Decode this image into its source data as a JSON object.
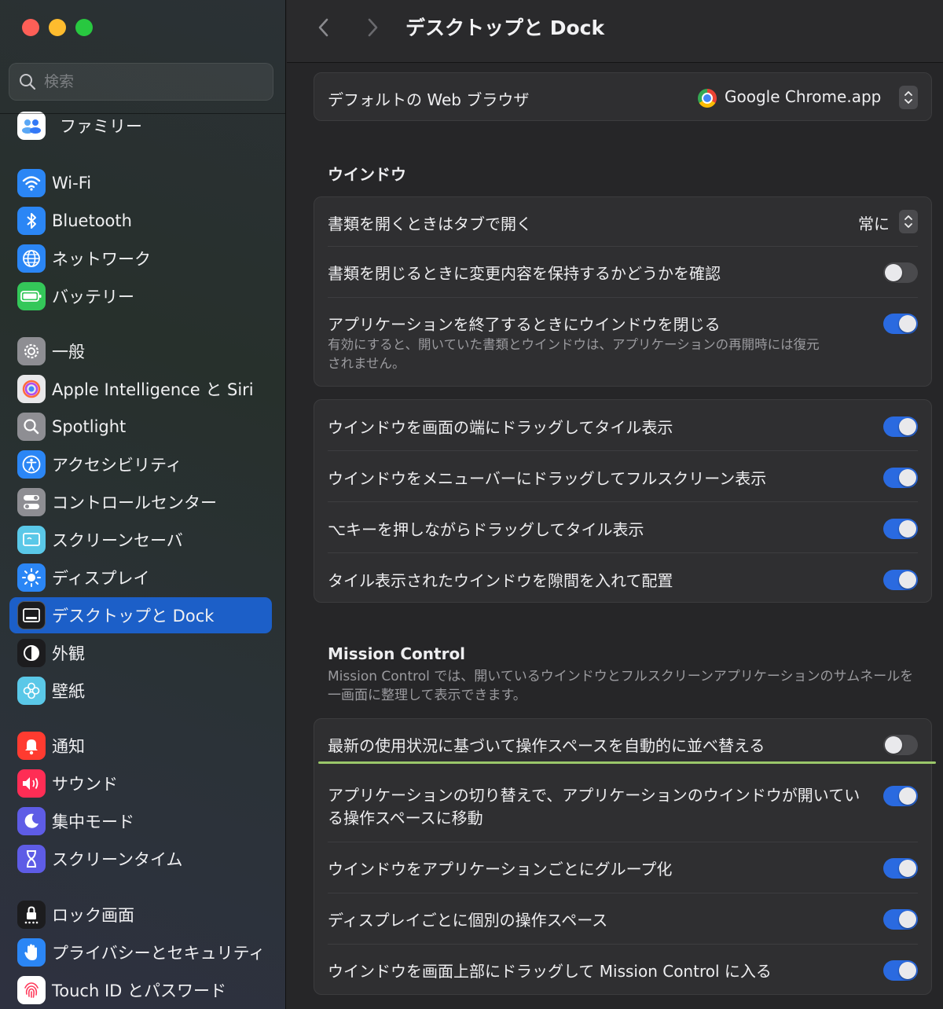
{
  "sidebar": {
    "search_placeholder": "検索",
    "items": [
      {
        "label": "ファミリー",
        "icon": "family-icon",
        "color": "#ffffff"
      },
      {
        "label": "Wi-Fi",
        "icon": "wifi-icon",
        "color": "#2b86f5"
      },
      {
        "label": "Bluetooth",
        "icon": "bluetooth-icon",
        "color": "#2b86f5"
      },
      {
        "label": "ネットワーク",
        "icon": "globe-icon",
        "color": "#2b86f5"
      },
      {
        "label": "バッテリー",
        "icon": "battery-icon",
        "color": "#34c759"
      },
      {
        "label": "一般",
        "icon": "gear-icon",
        "color": "#8e8e93"
      },
      {
        "label": "Apple Intelligence と Siri",
        "icon": "siri-icon",
        "color": "#e8e8ea"
      },
      {
        "label": "Spotlight",
        "icon": "magnifier-icon",
        "color": "#8e8e93"
      },
      {
        "label": "アクセシビリティ",
        "icon": "accessibility-icon",
        "color": "#2b86f5"
      },
      {
        "label": "コントロールセンター",
        "icon": "control-center-icon",
        "color": "#8e8e93"
      },
      {
        "label": "スクリーンセーバ",
        "icon": "screensaver-icon",
        "color": "#5ac8e8"
      },
      {
        "label": "ディスプレイ",
        "icon": "sun-icon",
        "color": "#2b86f5"
      },
      {
        "label": "デスクトップと Dock",
        "icon": "dock-icon",
        "color": "#1c1c1e"
      },
      {
        "label": "外観",
        "icon": "appearance-icon",
        "color": "#1c1c1e"
      },
      {
        "label": "壁紙",
        "icon": "wallpaper-icon",
        "color": "#5ac8e8"
      },
      {
        "label": "通知",
        "icon": "bell-icon",
        "color": "#ff3b30"
      },
      {
        "label": "サウンド",
        "icon": "speaker-icon",
        "color": "#ff2d55"
      },
      {
        "label": "集中モード",
        "icon": "moon-icon",
        "color": "#5e5ce6"
      },
      {
        "label": "スクリーンタイム",
        "icon": "hourglass-icon",
        "color": "#5e5ce6"
      },
      {
        "label": "ロック画面",
        "icon": "lock-icon",
        "color": "#1c1c1e"
      },
      {
        "label": "プライバシーとセキュリティ",
        "icon": "hand-icon",
        "color": "#2b86f5"
      },
      {
        "label": "Touch ID とパスワード",
        "icon": "fingerprint-icon",
        "color": "#ffffff"
      }
    ]
  },
  "header": {
    "title": "デスクトップと Dock"
  },
  "browser": {
    "label": "デフォルトの Web ブラウザ",
    "value": "Google Chrome.app"
  },
  "windows_section": {
    "title": "ウインドウ",
    "rows": [
      {
        "label": "書類を開くときはタブで開く",
        "value": "常に"
      },
      {
        "label": "書類を閉じるときに変更内容を保持するかどうかを確認"
      },
      {
        "label": "アプリケーションを終了するときにウインドウを閉じる",
        "sub": "有効にすると、開いていた書類とウインドウは、アプリケーションの再開時には復元されません。"
      }
    ]
  },
  "tiling": {
    "rows": [
      {
        "label": "ウインドウを画面の端にドラッグしてタイル表示"
      },
      {
        "label": "ウインドウをメニューバーにドラッグしてフルスクリーン表示"
      },
      {
        "label": "⌥キーを押しながらドラッグしてタイル表示"
      },
      {
        "label": "タイル表示されたウインドウを隙間を入れて配置"
      }
    ]
  },
  "mission_control": {
    "title": "Mission Control",
    "desc": "Mission Control では、開いているウインドウとフルスクリーンアプリケーションのサムネールを一画面に整理して表示できます。",
    "rows": [
      {
        "label": "最新の使用状況に基づいて操作スペースを自動的に並べ替える"
      },
      {
        "label": "アプリケーションの切り替えで、アプリケーションのウインドウが開いている操作スペースに移動"
      },
      {
        "label": "ウインドウをアプリケーションごとにグループ化"
      },
      {
        "label": "ディスプレイごとに個別の操作スペース"
      },
      {
        "label": "ウインドウを画面上部にドラッグして Mission Control に入る"
      }
    ]
  }
}
